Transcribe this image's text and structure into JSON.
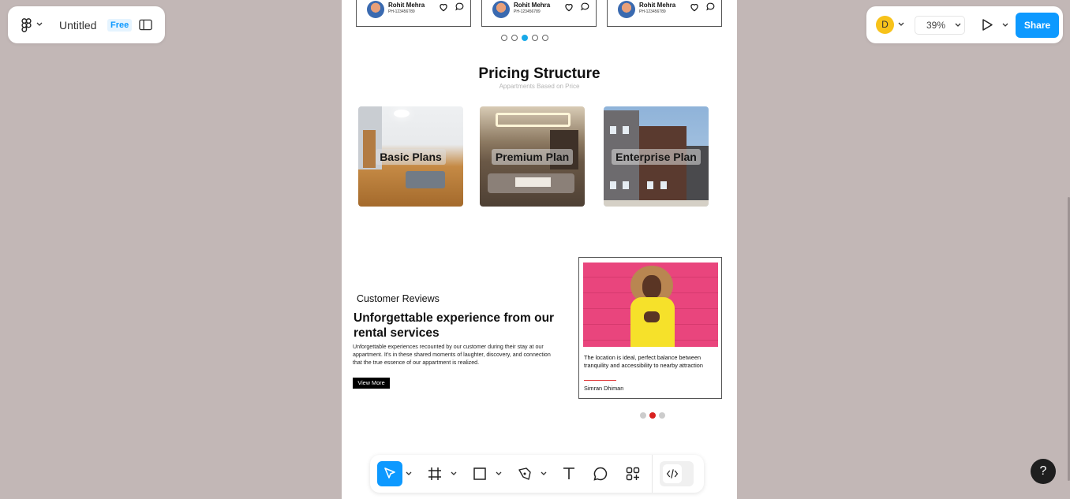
{
  "app": {
    "file_name": "Untitled",
    "plan_badge": "Free",
    "user_initial": "D",
    "zoom": "39%",
    "share_label": "Share",
    "help_label": "?"
  },
  "design": {
    "property_cards": [
      {
        "name": "Rohit Mehra",
        "phone": "PH-123456789"
      },
      {
        "name": "Rohit Mehra",
        "phone": "PH-123456789"
      },
      {
        "name": "Rohit Mehra",
        "phone": "PH-123456789"
      }
    ],
    "carousel_top": {
      "count": 5,
      "active_index": 2
    },
    "pricing": {
      "title": "Pricing Structure",
      "subtitle": "Appartments Based on Price",
      "plans": [
        {
          "label": "Basic Plans"
        },
        {
          "label": "Premium Plan"
        },
        {
          "label": "Enterprise Plan"
        }
      ]
    },
    "reviews": {
      "kicker": "Customer Reviews",
      "title": "Unforgettable experience from our rental services",
      "description": "Unforgettable experiences recounted by our customer during their stay at our appartment. It's in these shared moments of laughter, discovery, and connection that the true essence of our appartment is realized.",
      "button": "View More",
      "quote": "The location is ideal, perfect balance between tranquility and accessibility  to nearby attraction",
      "author": "Simran Dhiman",
      "carousel": {
        "count": 3,
        "active_index": 1
      }
    }
  },
  "colors": {
    "canvas": "#c2b7b6",
    "accent": "#0d99ff",
    "active_dot": "#18a9e8",
    "review_dot": "#d8211f"
  }
}
